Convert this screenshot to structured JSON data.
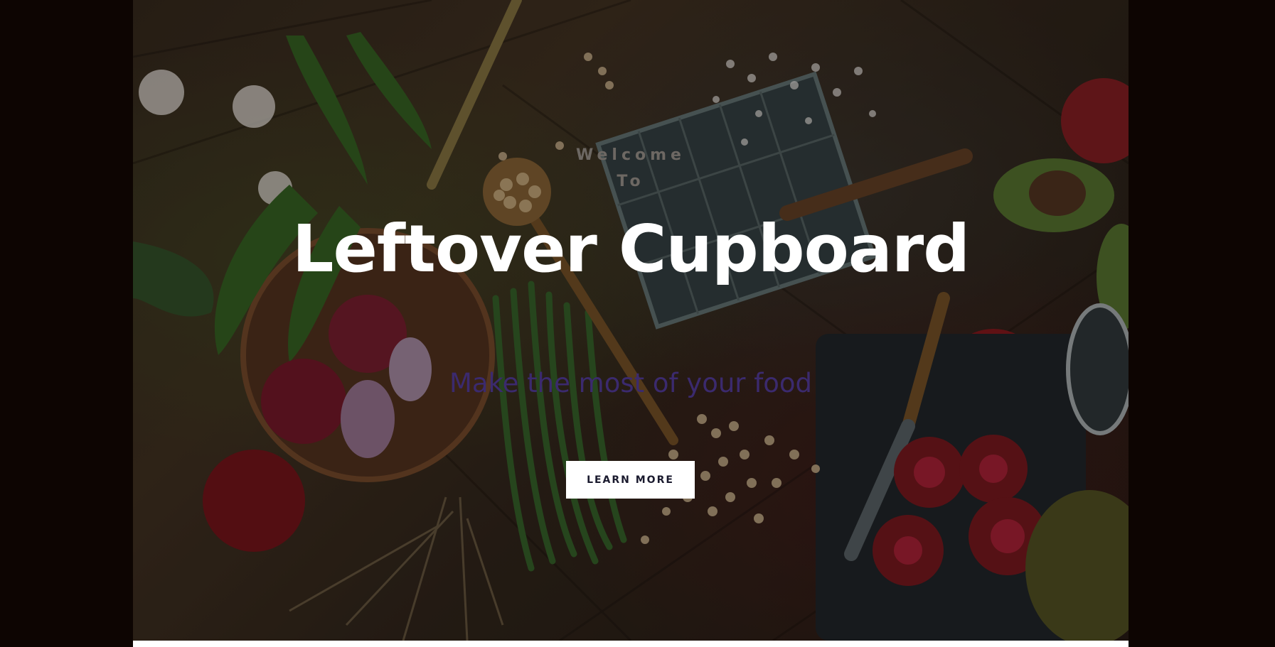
{
  "hero": {
    "welcome_line1": "Welcome",
    "welcome_line2": "To",
    "title": "Leftover Cupboard",
    "subtitle": "Make the most of your food",
    "cta_label": "LEARN MORE"
  },
  "colors": {
    "page_background": "#0d0502",
    "title_color": "#ffffff",
    "subtitle_color": "#3b2a6e",
    "welcome_color": "#6d6863",
    "button_background": "#ffffff",
    "button_text": "#1a1a2e"
  },
  "background_image": {
    "subject": "overhead food spread on wooden table"
  }
}
